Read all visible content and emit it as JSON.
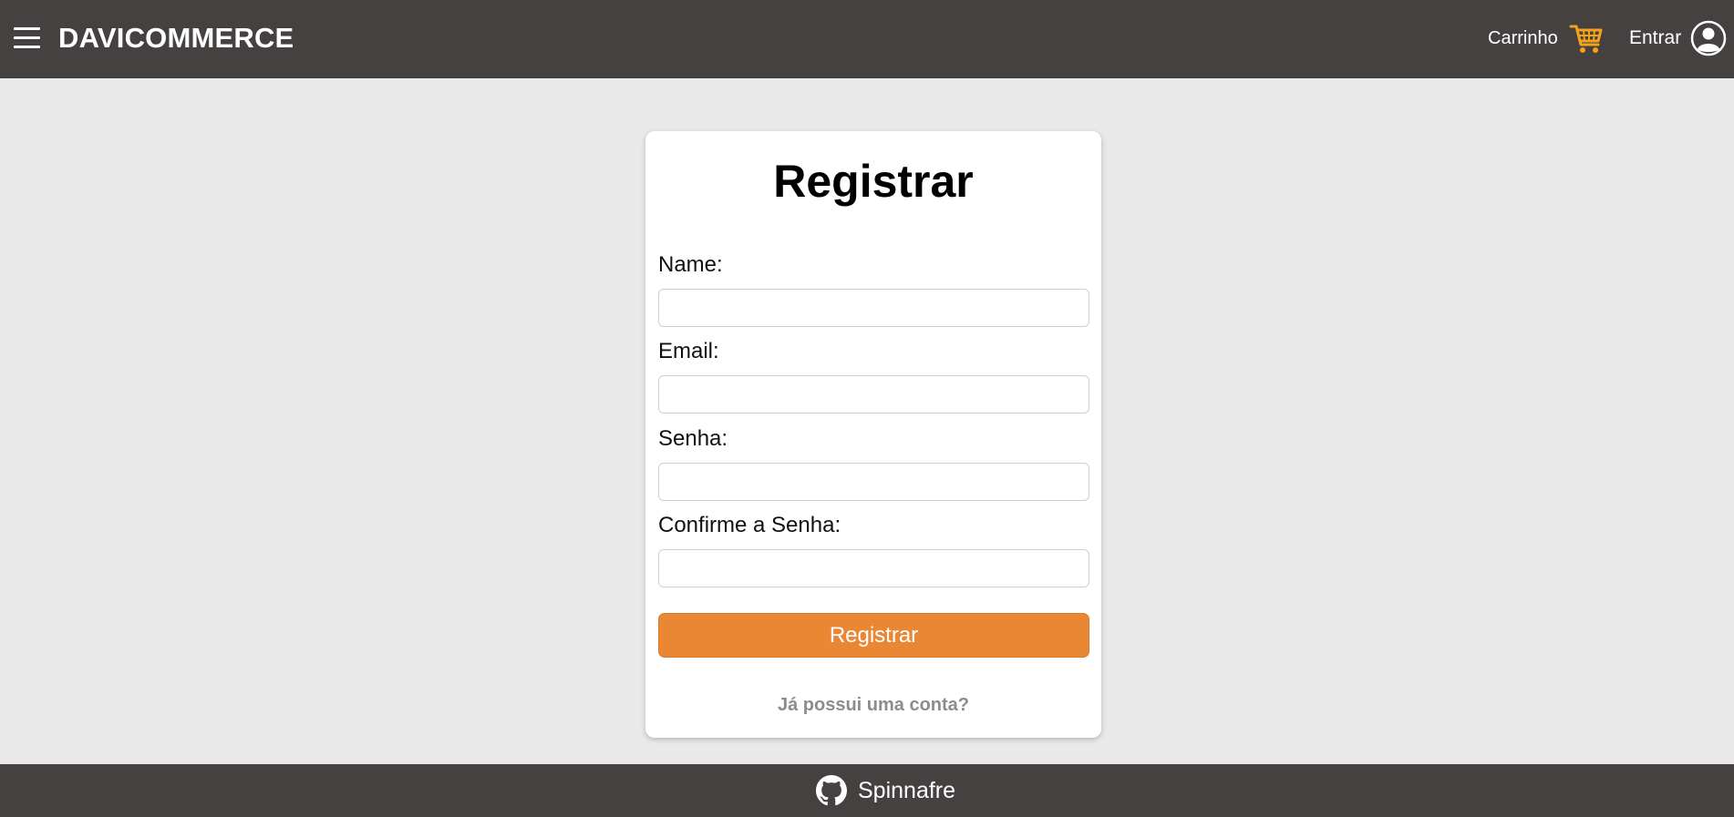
{
  "header": {
    "brand": "DAVICOMMERCE",
    "menu_icon": "hamburger-menu-icon",
    "cart_label": "Carrinho",
    "cart_icon": "shopping-cart-icon",
    "login_label": "Entrar",
    "login_icon": "user-circle-icon"
  },
  "form": {
    "title": "Registrar",
    "fields": [
      {
        "label": "Name:",
        "value": "",
        "placeholder": ""
      },
      {
        "label": "Email:",
        "value": "",
        "placeholder": ""
      },
      {
        "label": "Senha:",
        "value": "",
        "placeholder": ""
      },
      {
        "label": "Confirme a Senha:",
        "value": "",
        "placeholder": ""
      }
    ],
    "submit_label": "Registrar",
    "login_link": "Já possui uma conta?"
  },
  "footer": {
    "icon": "github-icon",
    "label": "Spinnafre"
  },
  "colors": {
    "header_bg": "#464141",
    "page_bg": "#e9e9e9",
    "accent": "#e98735",
    "cart_icon": "#f4a21a",
    "link": "#8c8c8c"
  }
}
